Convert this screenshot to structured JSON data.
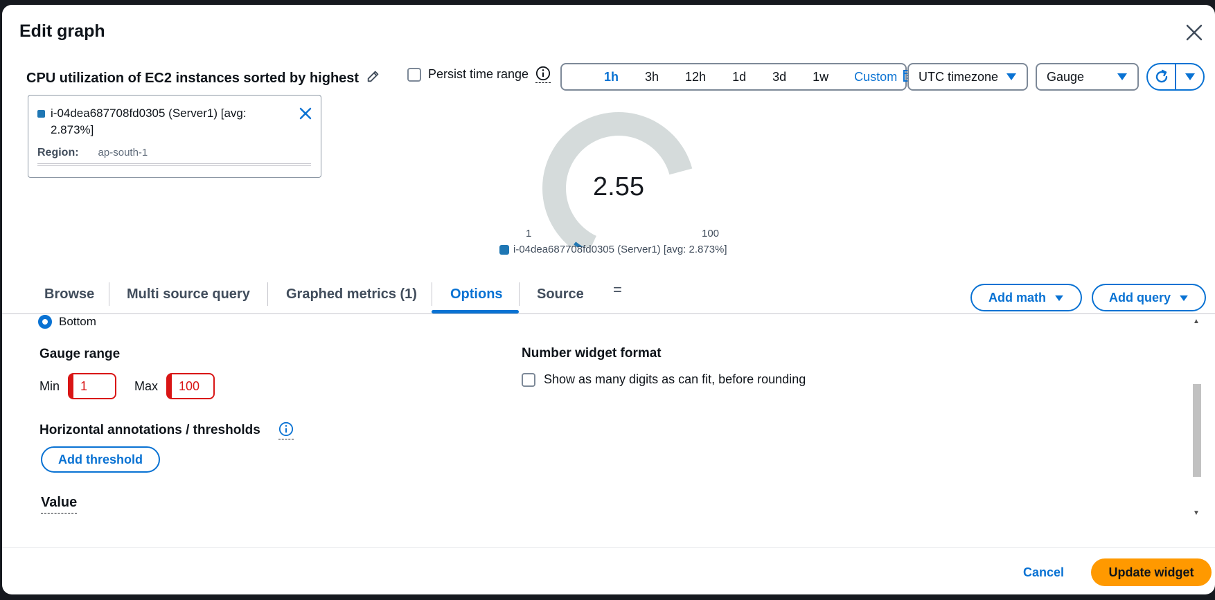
{
  "modal": {
    "title": "Edit graph"
  },
  "graph": {
    "title": "CPU utilization of EC2 instances sorted by highest"
  },
  "toolbar": {
    "persist_label": "Persist time range",
    "time_ranges": [
      "1h",
      "3h",
      "12h",
      "1d",
      "3d",
      "1w"
    ],
    "active_range": "1h",
    "custom_label": "Custom",
    "timezone": "UTC timezone",
    "visualization": "Gauge"
  },
  "metric": {
    "label": "i-04dea687708fd0305 (Server1) [avg: 2.873%]",
    "region_key": "Region:",
    "region_value": "ap-south-1",
    "color": "#1f77b4"
  },
  "gauge": {
    "value": "2.55",
    "min_label": "1",
    "max_label": "100",
    "min": 1,
    "max": 100,
    "current": 2.55,
    "legend": "i-04dea687708fd0305 (Server1) [avg: 2.873%]"
  },
  "tabs": {
    "items": [
      "Browse",
      "Multi source query",
      "Graphed metrics (1)",
      "Options",
      "Source"
    ],
    "active": "Options",
    "add_math": "Add math",
    "add_query": "Add query"
  },
  "options": {
    "legend_position": "Bottom",
    "gauge_range_title": "Gauge range",
    "min_label": "Min",
    "min_value": "1",
    "max_label": "Max",
    "max_value": "100",
    "thresholds_title": "Horizontal annotations / thresholds",
    "add_threshold": "Add threshold",
    "value_title": "Value",
    "number_format_title": "Number widget format",
    "number_format_check": "Show as many digits as can fit, before rounding"
  },
  "footer": {
    "cancel": "Cancel",
    "update": "Update widget"
  },
  "colors": {
    "accent": "#0972d3",
    "primary": "#ff9900",
    "error": "#d91515"
  }
}
